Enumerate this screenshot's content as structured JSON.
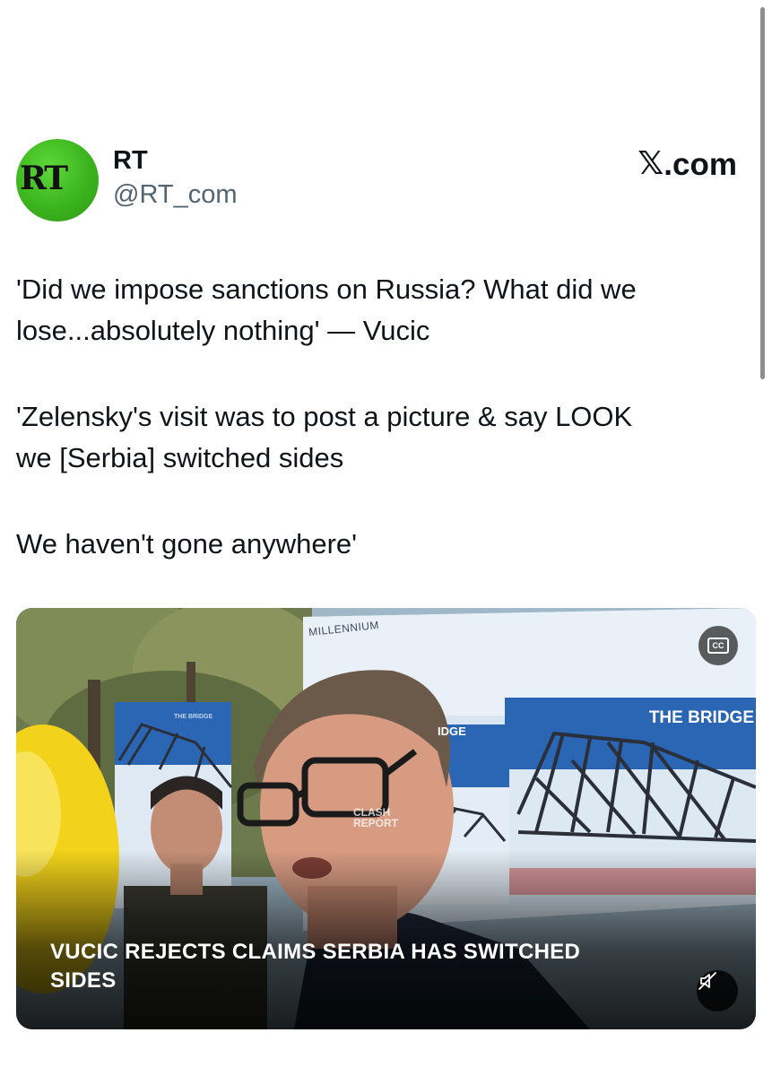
{
  "account": {
    "avatar_text": "RT",
    "display_name": "RT",
    "handle": "@RT_com"
  },
  "site": {
    "glyph": "𝕏",
    "label": ".com"
  },
  "tweet": {
    "paragraph_1_line_1": "'Did we impose sanctions on Russia? What did we",
    "paragraph_1_line_2": "lose...absolutely nothing' — Vucic",
    "paragraph_2_line_1": "'Zelensky's visit was to post a picture & say LOOK",
    "paragraph_2_line_2": "we [Serbia] switched sides",
    "paragraph_3": "We haven't gone anywhere'"
  },
  "video": {
    "caption_line_1": "VUCIC REJECTS CLAIMS SERBIA HAS SWITCHED",
    "caption_line_2": "SIDES",
    "cc_label": "CC",
    "watermark_line_1": "CLASH",
    "watermark_line_2": "REPORT",
    "sign_right": "THE BRIDGE",
    "sign_middle": "IDGE",
    "sign_left": "THE BRIDGE",
    "banner_top": "MILLENNIUM"
  },
  "colors": {
    "avatar_green": "#3bb41d",
    "text_primary": "#0f1419",
    "text_secondary": "#536471"
  },
  "icons": {
    "cc": "closed-captions-icon",
    "mute": "speaker-muted-icon",
    "site": "x-logo-icon"
  }
}
